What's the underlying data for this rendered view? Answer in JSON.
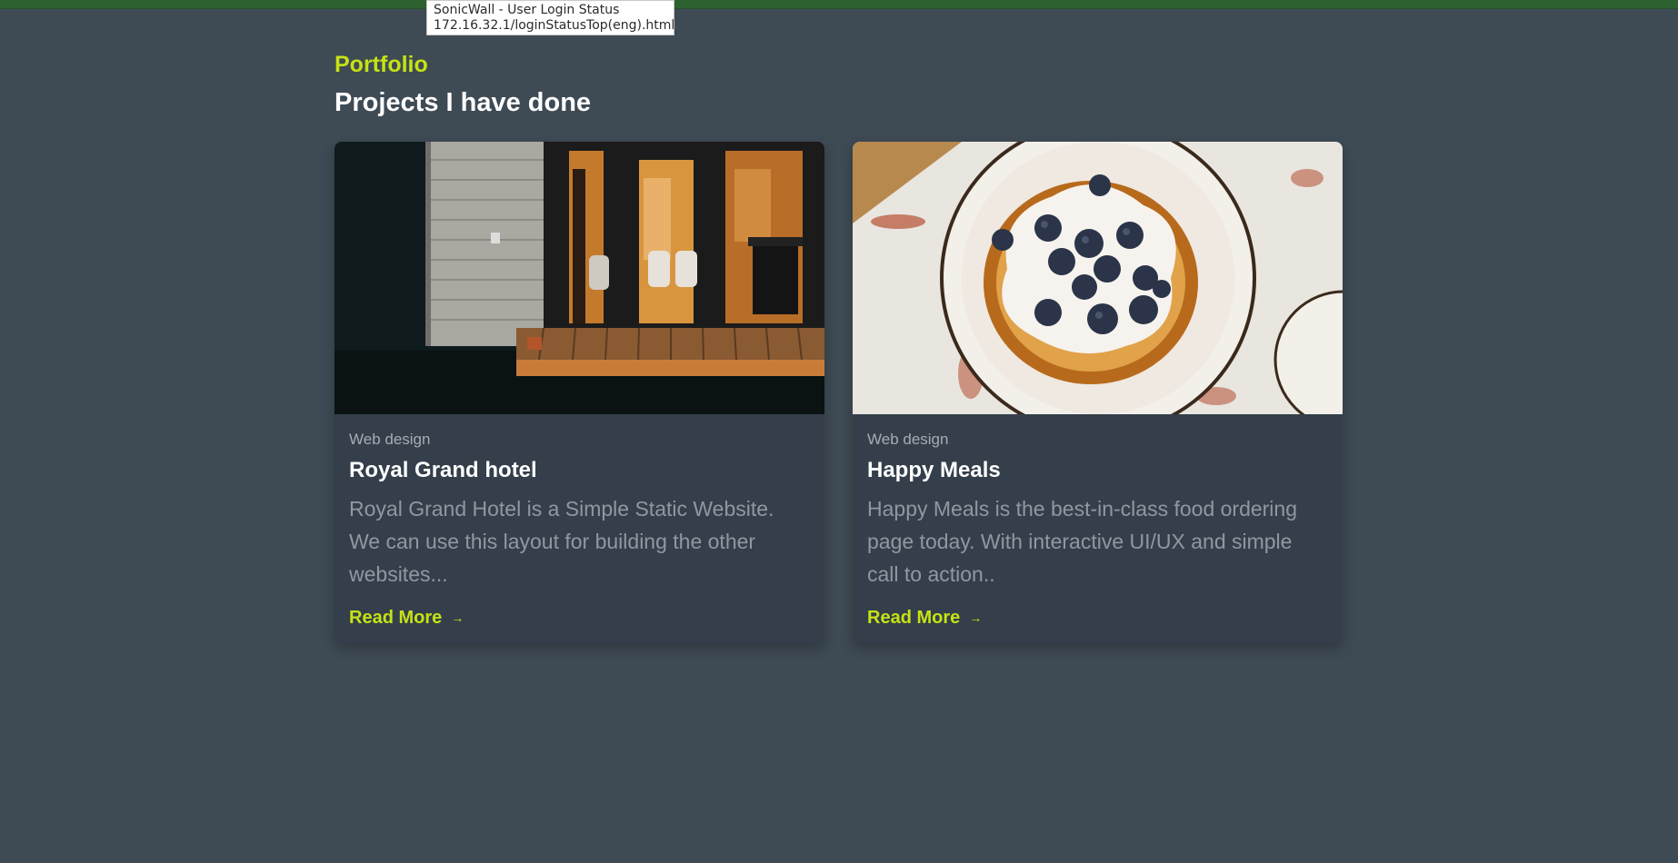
{
  "tooltip": {
    "line1": "SonicWall - User Login Status",
    "line2": "172.16.32.1/loginStatusTop(eng).html"
  },
  "section": {
    "eyebrow": "Portfolio",
    "heading": "Projects I have done"
  },
  "projects": [
    {
      "category": "Web design",
      "title": "Royal Grand hotel",
      "description": "Royal Grand Hotel is a Simple Static Website. We can use this layout for building the other websites...",
      "link_label": "Read More",
      "arrow": "→"
    },
    {
      "category": "Web design",
      "title": "Happy Meals",
      "description": "Happy Meals is the best-in-class food ordering page today. With interactive UI/UX and simple call to action..",
      "link_label": "Read More",
      "arrow": "→"
    }
  ],
  "colors": {
    "background": "#3e4a54",
    "card": "#343f4b",
    "accent": "#c6e214",
    "top_strip": "#2d6130"
  }
}
